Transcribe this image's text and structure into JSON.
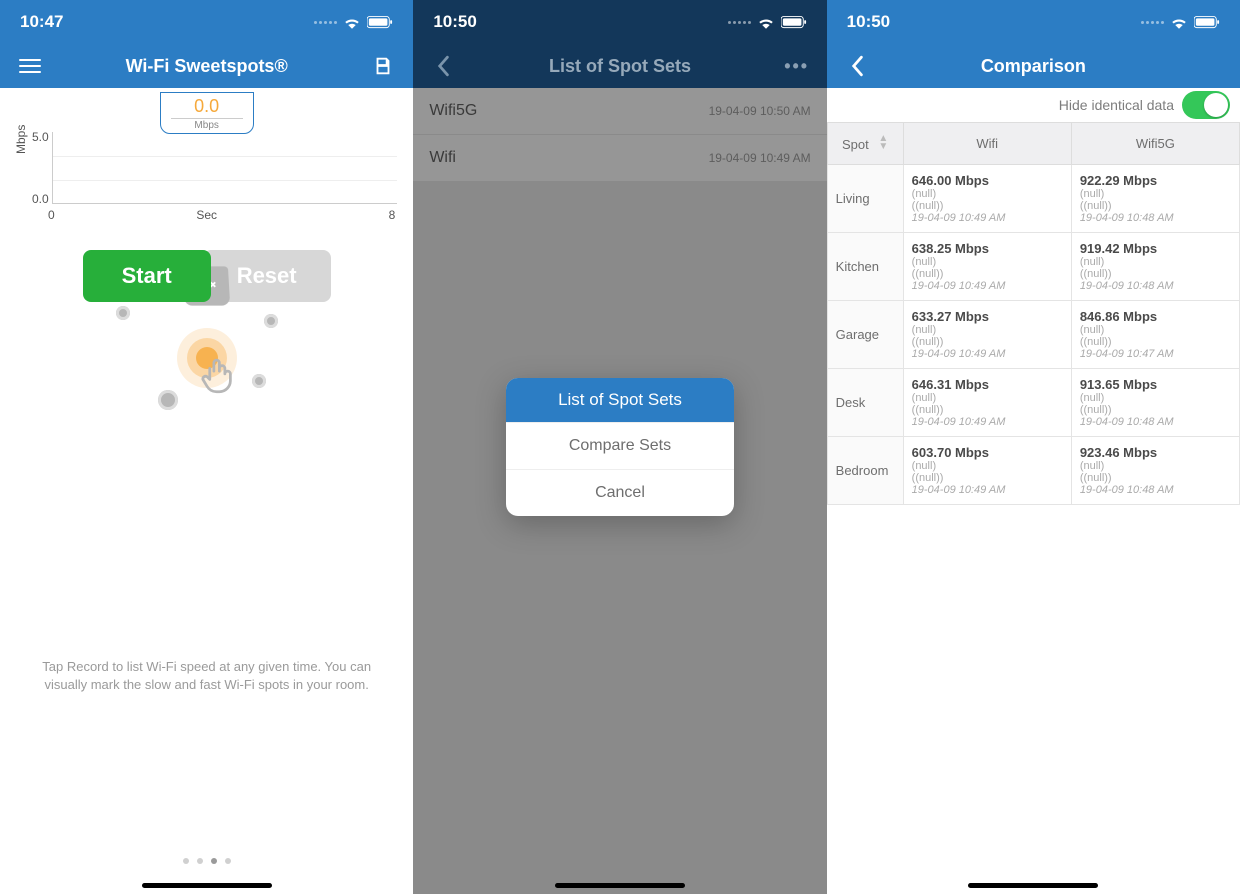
{
  "screen1": {
    "time": "10:47",
    "title": "Wi-Fi Sweetspots®",
    "speed_value": "0.0",
    "speed_unit": "Mbps",
    "y_axis_label": "Mbps",
    "y_max": "5.0",
    "y_min": "0.0",
    "x_min": "0",
    "x_label": "Sec",
    "x_max": "8",
    "start_label": "Start",
    "reset_label": "Reset",
    "hint": "Tap Record to list Wi-Fi speed at any given time. You can visually mark the slow and fast Wi-Fi spots in your room.",
    "page_index_active": 2,
    "page_count": 4
  },
  "screen2": {
    "time": "10:50",
    "title": "List of Spot Sets",
    "rows": [
      {
        "name": "Wifi5G",
        "ts": "19-04-09 10:50 AM"
      },
      {
        "name": "Wifi",
        "ts": "19-04-09 10:49 AM"
      }
    ],
    "sheet_title": "List of Spot Sets",
    "sheet_compare": "Compare Sets",
    "sheet_cancel": "Cancel"
  },
  "screen3": {
    "time": "10:50",
    "title": "Comparison",
    "hide_label": "Hide identical data",
    "toggle_on": true,
    "columns": [
      "Spot",
      "Wifi",
      "Wifi5G"
    ],
    "rows": [
      {
        "spot": "Living",
        "a": {
          "speed": "646.00 Mbps",
          "n1": "(null)",
          "n2": "((null))",
          "ts": "19-04-09 10:49 AM"
        },
        "b": {
          "speed": "922.29 Mbps",
          "n1": "(null)",
          "n2": "((null))",
          "ts": "19-04-09 10:48 AM"
        }
      },
      {
        "spot": "Kitchen",
        "a": {
          "speed": "638.25 Mbps",
          "n1": "(null)",
          "n2": "((null))",
          "ts": "19-04-09 10:49 AM"
        },
        "b": {
          "speed": "919.42 Mbps",
          "n1": "(null)",
          "n2": "((null))",
          "ts": "19-04-09 10:48 AM"
        }
      },
      {
        "spot": "Garage",
        "a": {
          "speed": "633.27 Mbps",
          "n1": "(null)",
          "n2": "((null))",
          "ts": "19-04-09 10:49 AM"
        },
        "b": {
          "speed": "846.86 Mbps",
          "n1": "(null)",
          "n2": "((null))",
          "ts": "19-04-09 10:47 AM"
        }
      },
      {
        "spot": "Desk",
        "a": {
          "speed": "646.31 Mbps",
          "n1": "(null)",
          "n2": "((null))",
          "ts": "19-04-09 10:49 AM"
        },
        "b": {
          "speed": "913.65 Mbps",
          "n1": "(null)",
          "n2": "((null))",
          "ts": "19-04-09 10:48 AM"
        }
      },
      {
        "spot": "Bedroom",
        "a": {
          "speed": "603.70 Mbps",
          "n1": "(null)",
          "n2": "((null))",
          "ts": "19-04-09 10:49 AM"
        },
        "b": {
          "speed": "923.46 Mbps",
          "n1": "(null)",
          "n2": "((null))",
          "ts": "19-04-09 10:48 AM"
        }
      }
    ]
  },
  "chart_data": {
    "type": "line",
    "x": [],
    "y": [],
    "title": "",
    "xlabel": "Sec",
    "ylabel": "Mbps",
    "xlim": [
      0,
      8
    ],
    "ylim": [
      0.0,
      5.0
    ],
    "current_value": 0.0,
    "unit": "Mbps"
  }
}
